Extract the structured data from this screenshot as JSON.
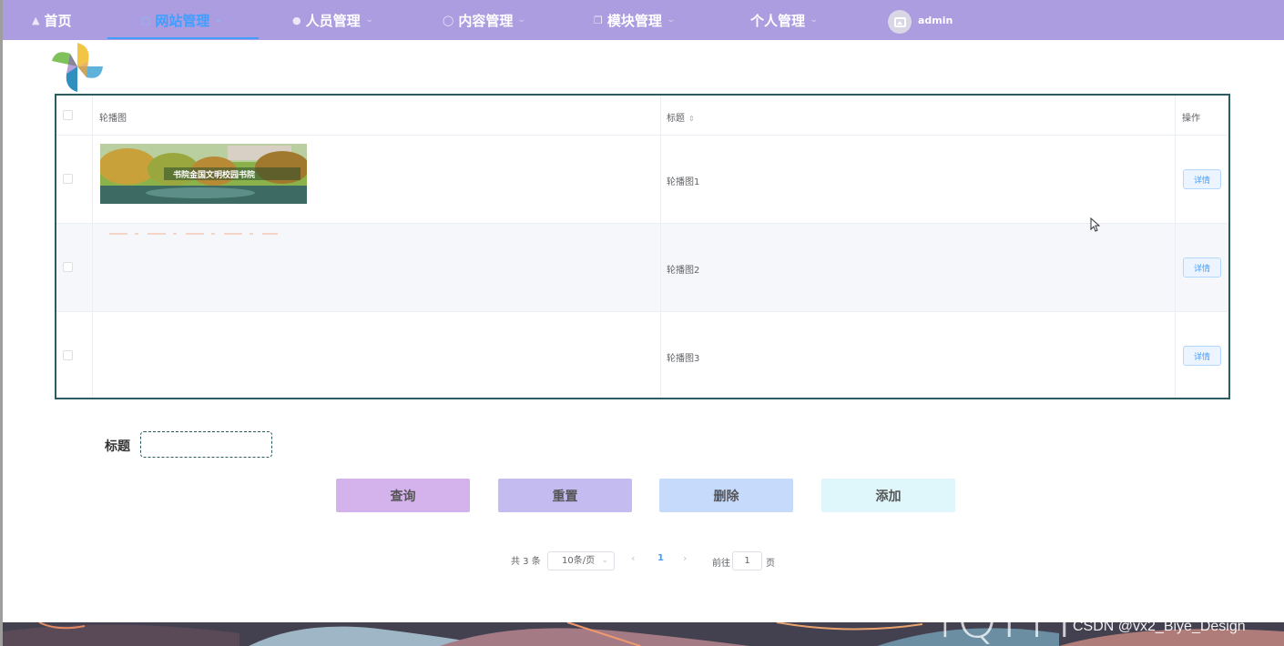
{
  "nav": {
    "home": "首页",
    "site": "网站管理",
    "people": "人员管理",
    "content": "内容管理",
    "module": "模块管理",
    "personal": "个人管理",
    "user": "admin"
  },
  "table": {
    "headers": {
      "image": "轮播图",
      "title": "标题",
      "action": "操作"
    },
    "rows": [
      {
        "title": "轮播图1",
        "action": "详情"
      },
      {
        "title": "轮播图2",
        "action": "详情"
      },
      {
        "title": "轮播图3",
        "action": "详情"
      }
    ],
    "banner_caption": "书院金国文明校园书院"
  },
  "search": {
    "label": "标题",
    "value": ""
  },
  "buttons": {
    "query": "查询",
    "reset": "重置",
    "delete": "删除",
    "add": "添加"
  },
  "pagination": {
    "total": "共 3 条",
    "page_size": "10条/页",
    "current": "1",
    "goto_label": "前往",
    "goto_value": "1",
    "page_suffix": "页"
  },
  "watermark": {
    "logo": "iQIYI",
    "text": "CSDN @vx2_Biye_Design"
  },
  "colors": {
    "nav_bg": "#ab9ddf",
    "active_link": "#409eff",
    "table_border": "#2b5c61",
    "query_btn": "#d4b2ec",
    "reset_btn": "#c4bcf0",
    "delete_btn": "#c6dafc",
    "add_btn": "#dff6fb"
  }
}
